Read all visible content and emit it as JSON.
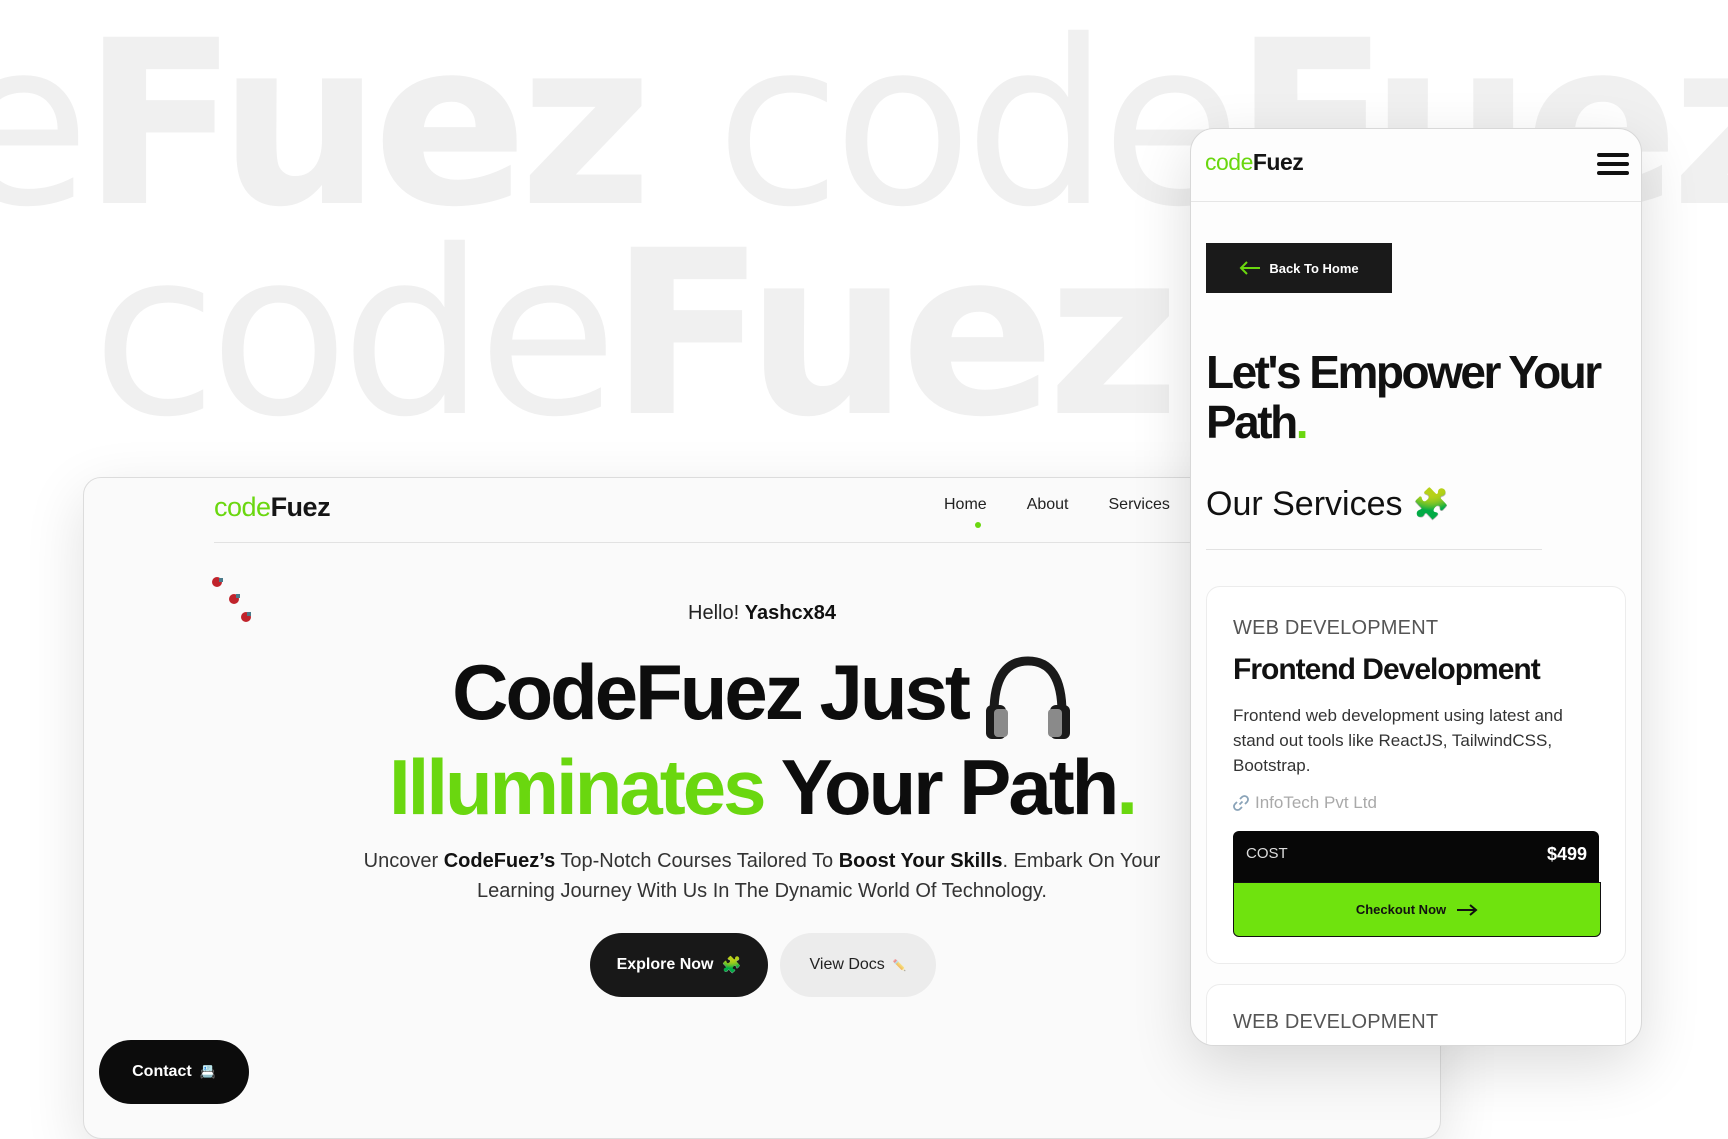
{
  "watermark": {
    "line1_light_prefix": "e",
    "line1_heavy_a": "Fuez ",
    "line1_light_b": "code",
    "line1_heavy_b": "Fuez",
    "line2_light": "code",
    "line2_heavy": "Fuez"
  },
  "desktop": {
    "logo_light": "code",
    "logo_bold": "Fuez",
    "nav": [
      "Home",
      "About",
      "Services"
    ],
    "greeting_prefix": "Hello!",
    "greeting_name": "Yashcx84",
    "hero_line1": "CodeFuez Just",
    "hero_green": "Illuminates",
    "hero_rest": "Your Path",
    "hero_dot": ".",
    "desc_a": "Uncover ",
    "desc_b": "CodeFuez’s",
    "desc_c": " Top-Notch Courses Tailored To ",
    "desc_d": "Boost Your Skills",
    "desc_e": ". Embark On Your",
    "desc_f": "Learning Journey With Us In The Dynamic World Of Technology.",
    "explore_label": "Explore Now",
    "explore_icon": "🧩",
    "docs_label": "View Docs",
    "docs_icon": "✏️",
    "contact_label": "Contact",
    "contact_icon": "📇"
  },
  "mobile": {
    "logo_light": "code",
    "logo_bold": "Fuez",
    "back_label": "Back To Home",
    "title": "Let's Empower Your Path",
    "title_dot": ".",
    "services_heading": "Our Services",
    "services_icon": "🧩",
    "cards": [
      {
        "category": "WEB DEVELOPMENT",
        "title": "Frontend Development",
        "description": "Frontend web development using latest and stand out tools like ReactJS, TailwindCSS, Bootstrap.",
        "company": "InfoTech Pvt Ltd",
        "cost_label": "COST",
        "price": "$499",
        "cta": "Checkout Now"
      },
      {
        "category": "WEB DEVELOPMENT"
      }
    ]
  },
  "colors": {
    "accent_green": "#6ad70f",
    "dark": "#111111",
    "watermark": "#f0f0f0"
  }
}
